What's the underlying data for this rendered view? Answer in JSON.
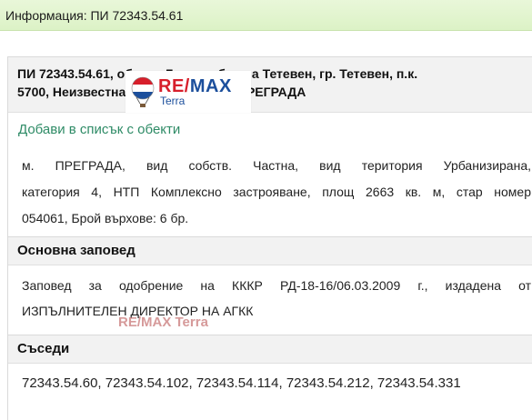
{
  "window": {
    "title": "Информация: ПИ 72343.54.61"
  },
  "property": {
    "heading_line1": "ПИ 72343.54.61, област Ловеч, община Тетевен, гр. Тетевен, п.к.",
    "heading_line2": "5700, Неизвестна улица, Местност ПРЕГРАДА",
    "add_to_list": "Добави в списък с обекти",
    "description_line1": "м. ПРЕГРАДА, вид собств. Частна, вид територия Урбанизирана,",
    "description_line2": "категория 4, НТП Комплексно застрояване, площ 2663 кв. м, стар номер",
    "description_line3": "054061, Брой върхове: 6 бр."
  },
  "order_section": {
    "title": "Основна заповед",
    "line1": "Заповед за одобрение на КККР РД-18-16/06.03.2009 г., издадена от",
    "line2": "ИЗПЪЛНИТЕЛЕН ДИРЕКТОР НА АГКК"
  },
  "neighbors_section": {
    "title": "Съседи",
    "values": "72343.54.60, 72343.54.102, 72343.54.114, 72343.54.212, 72343.54.331"
  },
  "logo": {
    "remax_red": "RE/",
    "remax_blue": "MAX",
    "terra": "Terra"
  },
  "watermark": {
    "text": "RE/MAX Terra"
  },
  "colors": {
    "titlebar_bg": "#dcf2c6",
    "link": "#2e8b66",
    "brand_red": "#d71f2b",
    "brand_blue": "#1c4f9c"
  }
}
